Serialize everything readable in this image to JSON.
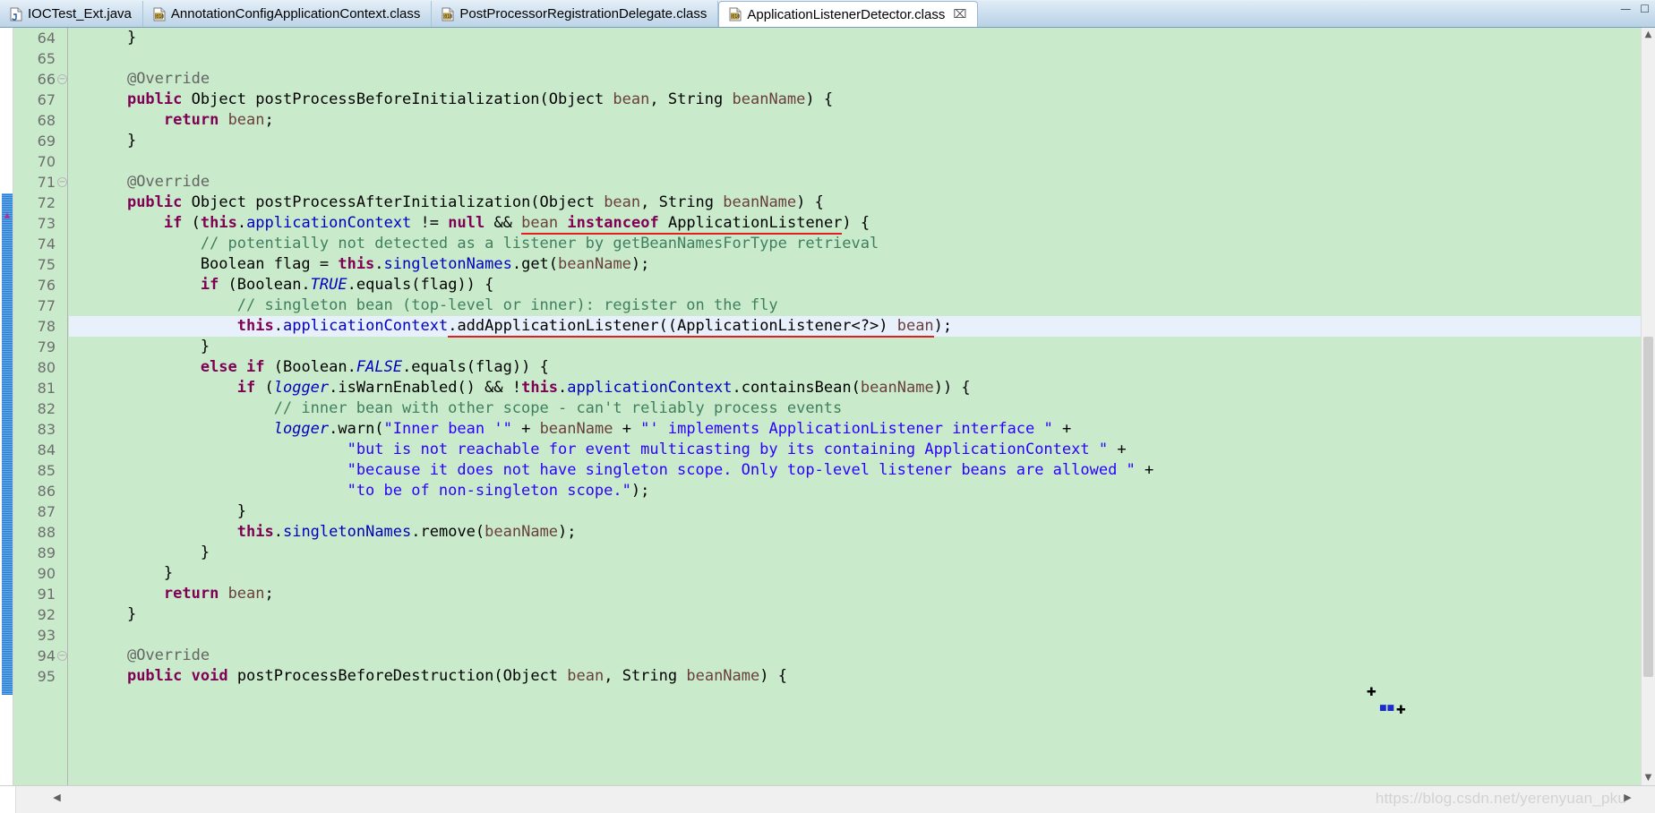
{
  "window": {
    "minimize_glyph": "—",
    "maximize_glyph": "☐"
  },
  "tabs": [
    {
      "label": "IOCTest_Ext.java",
      "icon": "java-file-icon",
      "active": false,
      "closable": false
    },
    {
      "label": "AnnotationConfigApplicationContext.class",
      "icon": "class-file-icon",
      "active": false,
      "closable": false
    },
    {
      "label": "PostProcessorRegistrationDelegate.class",
      "icon": "class-file-icon",
      "active": false,
      "closable": false
    },
    {
      "label": "ApplicationListenerDetector.class",
      "icon": "class-file-icon",
      "active": true,
      "closable": true,
      "close_glyph": "⌧"
    }
  ],
  "editor": {
    "first_line": 64,
    "highlighted_line": 78,
    "fold_markers": [
      66,
      71
    ],
    "colors": {
      "background": "#c9ebcb",
      "current_line": "#e8f0fb",
      "keyword": "#7f0055",
      "field": "#0000c0",
      "comment": "#3f7f5f",
      "string": "#2a00ff",
      "parameter": "#6a3e3e",
      "annotation": "#646464",
      "underline_error": "#e02020",
      "change_bar": "#1b76d2"
    },
    "lines": [
      {
        "n": 64,
        "tokens": [
          {
            "t": "    }",
            "c": "plain"
          }
        ]
      },
      {
        "n": 65,
        "tokens": []
      },
      {
        "n": 66,
        "fold": true,
        "tokens": [
          {
            "t": "    ",
            "c": "plain"
          },
          {
            "t": "@Override",
            "c": "ann"
          }
        ]
      },
      {
        "n": 67,
        "tokens": [
          {
            "t": "    ",
            "c": "plain"
          },
          {
            "t": "public",
            "c": "kw"
          },
          {
            "t": " Object postProcessBeforeInitialization(Object ",
            "c": "plain"
          },
          {
            "t": "bean",
            "c": "par"
          },
          {
            "t": ", String ",
            "c": "plain"
          },
          {
            "t": "beanName",
            "c": "par"
          },
          {
            "t": ") {",
            "c": "plain"
          }
        ]
      },
      {
        "n": 68,
        "tokens": [
          {
            "t": "        ",
            "c": "plain"
          },
          {
            "t": "return",
            "c": "kw"
          },
          {
            "t": " ",
            "c": "plain"
          },
          {
            "t": "bean",
            "c": "par"
          },
          {
            "t": ";",
            "c": "plain"
          }
        ]
      },
      {
        "n": 69,
        "tokens": [
          {
            "t": "    }",
            "c": "plain"
          }
        ]
      },
      {
        "n": 70,
        "tokens": []
      },
      {
        "n": 71,
        "fold": true,
        "tokens": [
          {
            "t": "    ",
            "c": "plain"
          },
          {
            "t": "@Override",
            "c": "ann"
          }
        ]
      },
      {
        "n": 72,
        "tokens": [
          {
            "t": "    ",
            "c": "plain"
          },
          {
            "t": "public",
            "c": "kw"
          },
          {
            "t": " Object postProcessAfterInitialization(Object ",
            "c": "plain"
          },
          {
            "t": "bean",
            "c": "par"
          },
          {
            "t": ", String ",
            "c": "plain"
          },
          {
            "t": "beanName",
            "c": "par"
          },
          {
            "t": ") {",
            "c": "plain"
          }
        ]
      },
      {
        "n": 73,
        "tokens": [
          {
            "t": "        ",
            "c": "plain"
          },
          {
            "t": "if",
            "c": "kw"
          },
          {
            "t": " (",
            "c": "plain"
          },
          {
            "t": "this",
            "c": "kw"
          },
          {
            "t": ".",
            "c": "plain"
          },
          {
            "t": "applicationContext",
            "c": "fld"
          },
          {
            "t": " != ",
            "c": "plain"
          },
          {
            "t": "null",
            "c": "kw"
          },
          {
            "t": " && ",
            "c": "plain"
          },
          {
            "t": "bean",
            "c": "par",
            "u": true
          },
          {
            "t": " ",
            "c": "plain",
            "u": true
          },
          {
            "t": "instanceof",
            "c": "kw",
            "u": true
          },
          {
            "t": " ApplicationListener",
            "c": "plain",
            "u": true
          },
          {
            "t": ") {",
            "c": "plain"
          }
        ]
      },
      {
        "n": 74,
        "tokens": [
          {
            "t": "            // potentially not detected as a listener by getBeanNamesForType retrieval",
            "c": "cmt"
          }
        ]
      },
      {
        "n": 75,
        "tokens": [
          {
            "t": "            Boolean flag = ",
            "c": "plain"
          },
          {
            "t": "this",
            "c": "kw"
          },
          {
            "t": ".",
            "c": "plain"
          },
          {
            "t": "singletonNames",
            "c": "fld"
          },
          {
            "t": ".get(",
            "c": "plain"
          },
          {
            "t": "beanName",
            "c": "par"
          },
          {
            "t": ");",
            "c": "plain"
          }
        ]
      },
      {
        "n": 76,
        "tokens": [
          {
            "t": "            ",
            "c": "plain"
          },
          {
            "t": "if",
            "c": "kw"
          },
          {
            "t": " (Boolean.",
            "c": "plain"
          },
          {
            "t": "TRUE",
            "c": "sfld"
          },
          {
            "t": ".equals(flag)) {",
            "c": "plain"
          }
        ]
      },
      {
        "n": 77,
        "tokens": [
          {
            "t": "                // singleton bean (top-level or inner): register on the fly",
            "c": "cmt"
          }
        ]
      },
      {
        "n": 78,
        "highlight": true,
        "tokens": [
          {
            "t": "                ",
            "c": "plain"
          },
          {
            "t": "this",
            "c": "kw"
          },
          {
            "t": ".",
            "c": "plain"
          },
          {
            "t": "applicationContext",
            "c": "fld"
          },
          {
            "t": ".addApplicationListener((ApplicationListener<?>) ",
            "c": "plain",
            "u": true
          },
          {
            "t": "bean",
            "c": "par",
            "u": true
          },
          {
            "t": ");",
            "c": "plain"
          }
        ]
      },
      {
        "n": 79,
        "tokens": [
          {
            "t": "            }",
            "c": "plain"
          }
        ]
      },
      {
        "n": 80,
        "tokens": [
          {
            "t": "            ",
            "c": "plain"
          },
          {
            "t": "else",
            "c": "kw"
          },
          {
            "t": " ",
            "c": "plain"
          },
          {
            "t": "if",
            "c": "kw"
          },
          {
            "t": " (Boolean.",
            "c": "plain"
          },
          {
            "t": "FALSE",
            "c": "sfld"
          },
          {
            "t": ".equals(flag)) {",
            "c": "plain"
          }
        ]
      },
      {
        "n": 81,
        "tokens": [
          {
            "t": "                ",
            "c": "plain"
          },
          {
            "t": "if",
            "c": "kw"
          },
          {
            "t": " (",
            "c": "plain"
          },
          {
            "t": "logger",
            "c": "sfld"
          },
          {
            "t": ".isWarnEnabled() && !",
            "c": "plain"
          },
          {
            "t": "this",
            "c": "kw"
          },
          {
            "t": ".",
            "c": "plain"
          },
          {
            "t": "applicationContext",
            "c": "fld"
          },
          {
            "t": ".containsBean(",
            "c": "plain"
          },
          {
            "t": "beanName",
            "c": "par"
          },
          {
            "t": ")) {",
            "c": "plain"
          }
        ]
      },
      {
        "n": 82,
        "tokens": [
          {
            "t": "                    // inner bean with other scope - can't reliably process events",
            "c": "cmt"
          }
        ]
      },
      {
        "n": 83,
        "tokens": [
          {
            "t": "                    ",
            "c": "plain"
          },
          {
            "t": "logger",
            "c": "sfld"
          },
          {
            "t": ".warn(",
            "c": "plain"
          },
          {
            "t": "\"Inner bean '\"",
            "c": "str"
          },
          {
            "t": " + ",
            "c": "plain"
          },
          {
            "t": "beanName",
            "c": "par"
          },
          {
            "t": " + ",
            "c": "plain"
          },
          {
            "t": "\"' implements ApplicationListener interface \"",
            "c": "str"
          },
          {
            "t": " +",
            "c": "plain"
          }
        ]
      },
      {
        "n": 84,
        "tokens": [
          {
            "t": "                            ",
            "c": "plain"
          },
          {
            "t": "\"but is not reachable for event multicasting by its containing ApplicationContext \"",
            "c": "str"
          },
          {
            "t": " +",
            "c": "plain"
          }
        ]
      },
      {
        "n": 85,
        "tokens": [
          {
            "t": "                            ",
            "c": "plain"
          },
          {
            "t": "\"because it does not have singleton scope. Only top-level listener beans are allowed \"",
            "c": "str"
          },
          {
            "t": " +",
            "c": "plain"
          }
        ]
      },
      {
        "n": 86,
        "tokens": [
          {
            "t": "                            ",
            "c": "plain"
          },
          {
            "t": "\"to be of non-singleton scope.\"",
            "c": "str"
          },
          {
            "t": ");",
            "c": "plain"
          }
        ]
      },
      {
        "n": 87,
        "tokens": [
          {
            "t": "                }",
            "c": "plain"
          }
        ]
      },
      {
        "n": 88,
        "tokens": [
          {
            "t": "                ",
            "c": "plain"
          },
          {
            "t": "this",
            "c": "kw"
          },
          {
            "t": ".",
            "c": "plain"
          },
          {
            "t": "singletonNames",
            "c": "fld"
          },
          {
            "t": ".remove(",
            "c": "plain"
          },
          {
            "t": "beanName",
            "c": "par"
          },
          {
            "t": ");",
            "c": "plain"
          }
        ]
      },
      {
        "n": 89,
        "tokens": [
          {
            "t": "            }",
            "c": "plain"
          }
        ]
      },
      {
        "n": 90,
        "tokens": [
          {
            "t": "        }",
            "c": "plain"
          }
        ]
      },
      {
        "n": 91,
        "tokens": [
          {
            "t": "        ",
            "c": "plain"
          },
          {
            "t": "return",
            "c": "kw"
          },
          {
            "t": " ",
            "c": "plain"
          },
          {
            "t": "bean",
            "c": "par"
          },
          {
            "t": ";",
            "c": "plain"
          }
        ]
      },
      {
        "n": 92,
        "tokens": [
          {
            "t": "    }",
            "c": "plain"
          }
        ]
      },
      {
        "n": 93,
        "tokens": []
      },
      {
        "n": 94,
        "fold": true,
        "tokens": [
          {
            "t": "    ",
            "c": "plain"
          },
          {
            "t": "@Override",
            "c": "ann"
          }
        ]
      },
      {
        "n": 95,
        "tokens": [
          {
            "t": "    ",
            "c": "plain"
          },
          {
            "t": "public",
            "c": "kw"
          },
          {
            "t": " ",
            "c": "plain"
          },
          {
            "t": "void",
            "c": "kw"
          },
          {
            "t": " postProcessBeforeDestruction(Object ",
            "c": "plain"
          },
          {
            "t": "bean",
            "c": "par"
          },
          {
            "t": ", String ",
            "c": "plain"
          },
          {
            "t": "beanName",
            "c": "par"
          },
          {
            "t": ") {",
            "c": "plain"
          }
        ]
      }
    ]
  },
  "scrollbars": {
    "vertical_up_glyph": "▲",
    "vertical_down_glyph": "▼",
    "horizontal_left_glyph": "◀",
    "horizontal_right_glyph": "▶"
  },
  "watermark": {
    "text": "https://blog.csdn.net/yerenyuan_pku"
  }
}
